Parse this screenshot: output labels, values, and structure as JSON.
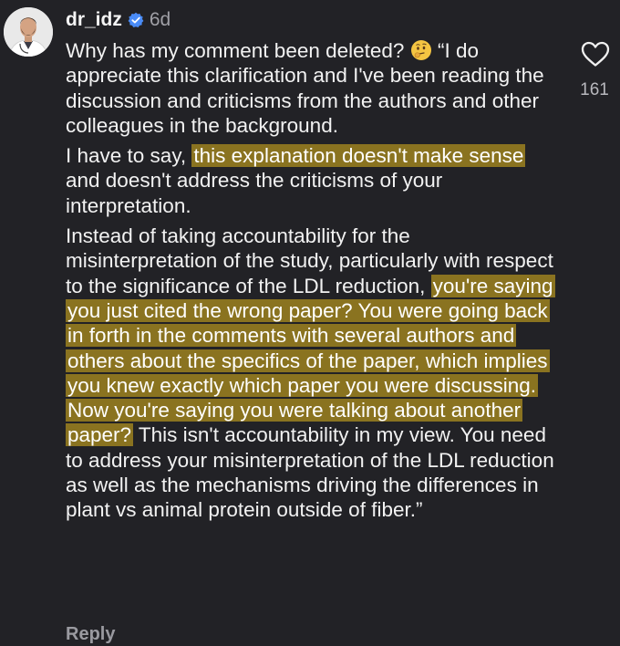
{
  "comment": {
    "username": "dr_idz",
    "time": "6d",
    "paragraph1": {
      "before_emoji": "Why has my comment been deleted? ",
      "after_emoji": " “I do appreciate this clarification and I've been reading the discussion and criticisms from the authors and other colleagues in the background."
    },
    "paragraph2": {
      "plain1": "I have to say, ",
      "highlight1": "this explanation doesn't make sense",
      "plain2": " and doesn't address the criticisms of your interpretation."
    },
    "paragraph3": {
      "plain1": "Instead of taking accountability for the misinterpretation of the study, particularly with respect to the significance of the LDL reduction, ",
      "highlight1": "you're saying you just cited the wrong paper? You were going back in forth in the comments with several authors and others about the specifics of the paper, which implies you knew exactly which paper you were discussing. Now you're saying you were talking about another paper?",
      "plain2": " This isn't accountability in my view. You need to address your misinterpretation of the LDL reduction as well as the mechanisms driving the differences in plant vs animal protein outside of fiber.”"
    },
    "reply_label": "Reply",
    "like_count": "161",
    "icons": {
      "verified": "verified-badge-icon",
      "emoji": "thinking-face-emoji",
      "like": "heart-outline-icon"
    },
    "colors": {
      "background": "#222226",
      "highlight": "#8a7320",
      "verified": "#4a8cf7"
    }
  }
}
